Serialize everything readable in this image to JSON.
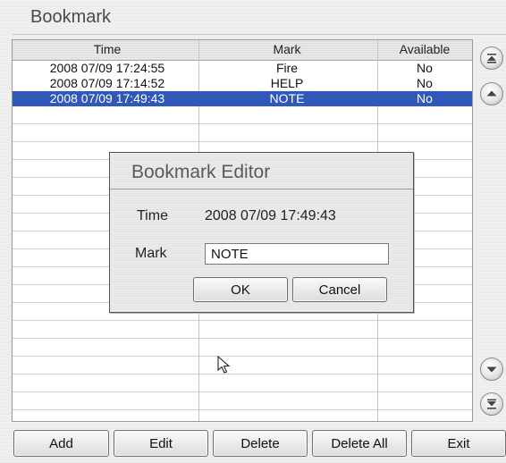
{
  "window": {
    "title": "Bookmark"
  },
  "table": {
    "columns": [
      "Time",
      "Mark",
      "Available"
    ],
    "rows": [
      {
        "time": "2008 07/09 17:24:55",
        "mark": "Fire",
        "available": "No",
        "selected": false
      },
      {
        "time": "2008 07/09 17:14:52",
        "mark": "HELP",
        "available": "No",
        "selected": false
      },
      {
        "time": "2008 07/09 17:49:43",
        "mark": "NOTE",
        "available": "No",
        "selected": true
      }
    ]
  },
  "dialog": {
    "title": "Bookmark Editor",
    "time_label": "Time",
    "time_value": "2008 07/09 17:49:43",
    "mark_label": "Mark",
    "mark_value": "NOTE",
    "ok_label": "OK",
    "cancel_label": "Cancel"
  },
  "scroll": {
    "top_icon": "scroll-to-top-icon",
    "up_icon": "scroll-up-icon",
    "down_icon": "scroll-down-icon",
    "bottom_icon": "scroll-to-bottom-icon"
  },
  "toolbar": {
    "add_label": "Add",
    "edit_label": "Edit",
    "delete_label": "Delete",
    "delete_all_label": "Delete All",
    "exit_label": "Exit"
  },
  "colors": {
    "selection": "#2f58b8",
    "selection_text": "#ffffff"
  }
}
